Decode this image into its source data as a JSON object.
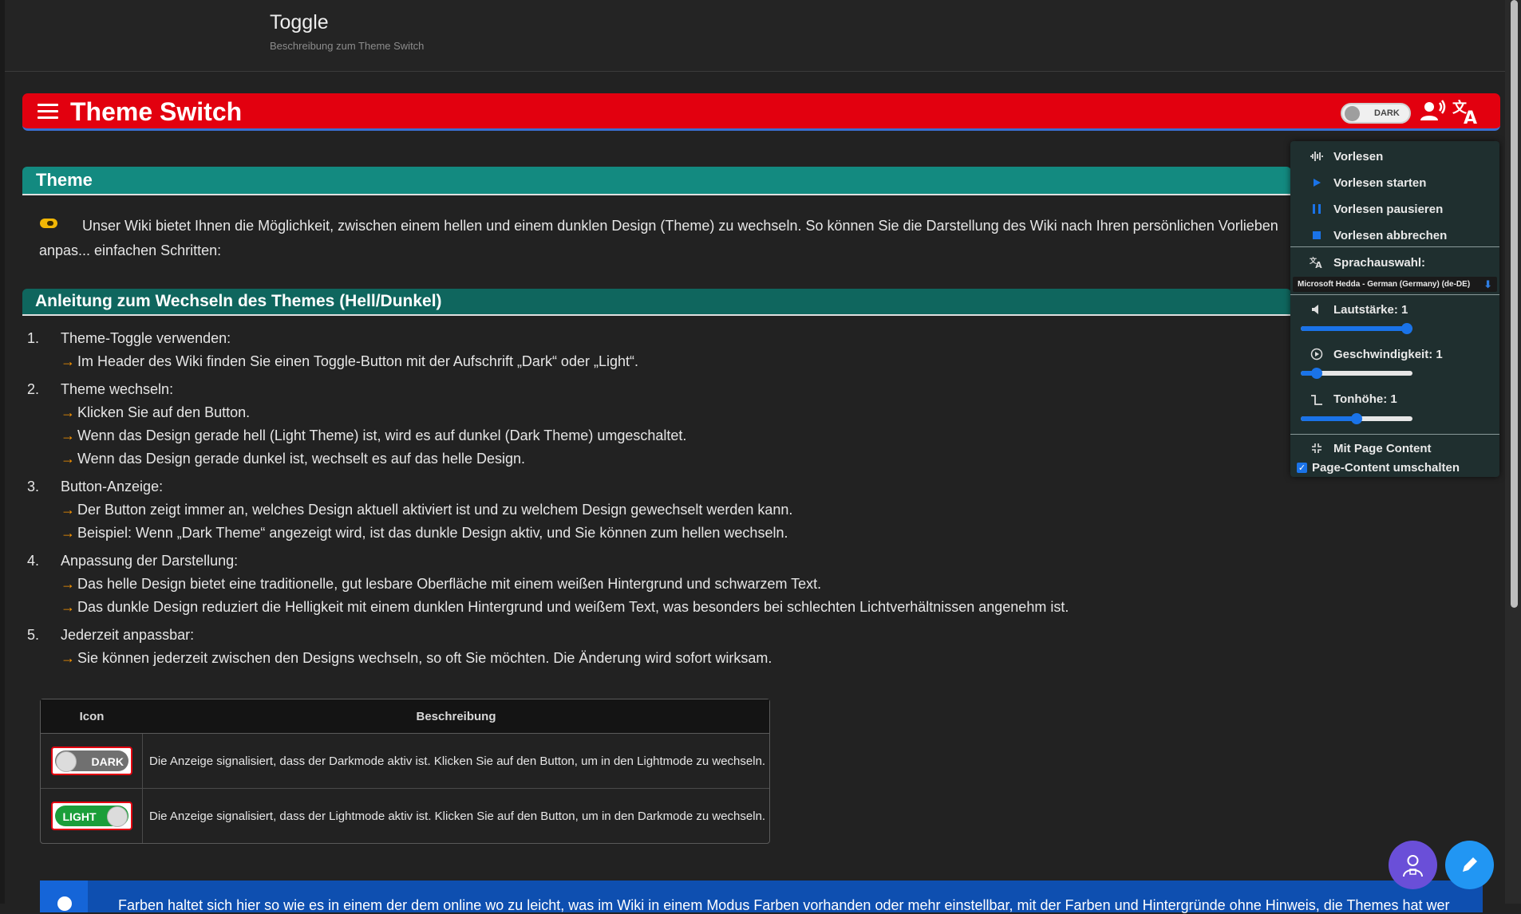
{
  "page": {
    "title": "Toggle",
    "subtitle": "Beschreibung zum Theme Switch"
  },
  "banner": {
    "title": "Theme Switch",
    "toggle_label": "DARK"
  },
  "section_theme": {
    "heading": "Theme",
    "intro": "Unser Wiki bietet Ihnen die Möglichkeit, zwischen einem hellen und einem dunklen Design (Theme) zu wechseln. So können Sie die Darstellung des Wiki nach Ihren persönlichen Vorlieben anpas... einfachen Schritten:"
  },
  "section_anleitung": {
    "heading": "Anleitung zum Wechseln des Themes (Hell/Dunkel)",
    "steps": [
      {
        "num": "1.",
        "title": "Theme-Toggle verwenden:",
        "subs": [
          "Im Header des Wiki finden Sie einen Toggle-Button mit der Aufschrift „Dark“ oder „Light“."
        ]
      },
      {
        "num": "2.",
        "title": "Theme wechseln:",
        "subs": [
          "Klicken Sie auf den Button.",
          "Wenn das Design gerade hell (Light Theme) ist, wird es auf dunkel (Dark Theme) umgeschaltet.",
          "Wenn das Design gerade dunkel ist, wechselt es auf das helle Design."
        ]
      },
      {
        "num": "3.",
        "title": "Button-Anzeige:",
        "subs": [
          "Der Button zeigt immer an, welches Design aktuell aktiviert ist und zu welchem Design gewechselt werden kann.",
          "Beispiel: Wenn „Dark Theme“ angezeigt wird, ist das dunkle Design aktiv, und Sie können zum hellen wechseln."
        ]
      },
      {
        "num": "4.",
        "title": "Anpassung der Darstellung:",
        "subs": [
          "Das helle Design bietet eine traditionelle, gut lesbare Oberfläche mit einem weißen Hintergrund und schwarzem Text.",
          "Das dunkle Design reduziert die Helligkeit mit einem dunklen Hintergrund und weißem Text, was besonders bei schlechten Lichtverhältnissen angenehm ist."
        ]
      },
      {
        "num": "5.",
        "title": "Jederzeit anpassbar:",
        "subs": [
          "Sie können jederzeit zwischen den Designs wechseln, so oft Sie möchten. Die Änderung wird sofort wirksam."
        ]
      }
    ]
  },
  "table": {
    "headers": [
      "Icon",
      "Beschreibung"
    ],
    "rows": [
      {
        "icon_label": "DARK",
        "desc": "Die Anzeige signalisiert, dass der Darkmode aktiv ist. Klicken Sie auf den Button, um in den Lightmode zu wechseln."
      },
      {
        "icon_label": "LIGHT",
        "desc": "Die Anzeige signalisiert, dass der Lightmode aktiv ist. Klicken Sie auf den Button, um in den Darkmode zu wechseln."
      }
    ]
  },
  "bottom_info": {
    "text": "Farben haltet sich hier so wie es in einem der dem online wo zu leicht, was im Wiki in einem Modus Farben vorhanden oder mehr einstellbar, mit der Farben und Hintergründe ohne Hinweis, die Themes hat wer"
  },
  "tts_panel": {
    "title": "Vorlesen",
    "start": "Vorlesen starten",
    "pause": "Vorlesen pausieren",
    "stop": "Vorlesen abbrechen",
    "lang_label": "Sprachauswahl:",
    "voice": "Microsoft Hedda - German (Germany) (de-DE)",
    "volume_label": "Lautstärke: 1",
    "volume_value": 1.0,
    "speed_label": "Geschwindigkeit: 1",
    "speed_value": 0.1,
    "pitch_label": "Tonhöhe: 1",
    "pitch_value": 0.5,
    "page_content_label": "Mit Page Content",
    "page_content_toggle": "Page-Content umschalten",
    "page_content_checked": true
  },
  "colors": {
    "banner": "#e2000f",
    "theme_heading": "#138a80",
    "anleitung_heading": "#0f665e",
    "arrow": "#ff9800",
    "panel_bg": "#1f2f2f",
    "accent": "#1a73e8"
  }
}
